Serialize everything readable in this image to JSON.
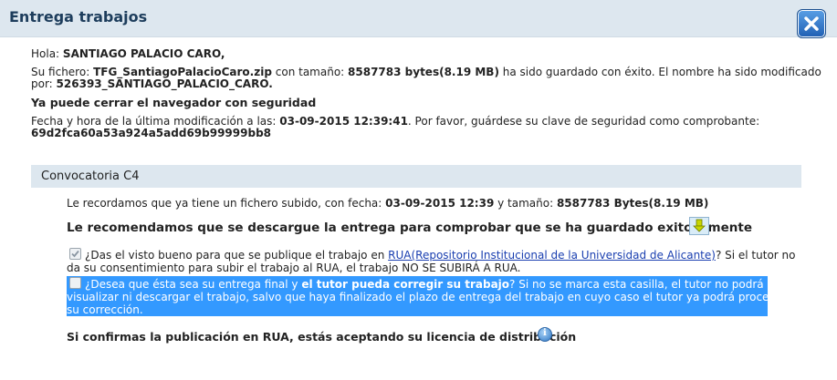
{
  "window": {
    "title": "Entrega trabajos",
    "close_label": "Cerrar"
  },
  "greeting": {
    "prefix": "Hola: ",
    "name": "SANTIAGO PALACIO CARO,"
  },
  "file": {
    "prefix": "Su fichero: ",
    "name": "TFG_SantiagoPalacioCaro.zip",
    "size_prefix": " con tamaño: ",
    "size": "8587783 bytes(8.19 MB)",
    "suffix": " ha sido guardado con éxito. El nombre ha sido modificado",
    "renamed_prefix": "por: ",
    "renamed": "526393_SANTIAGO_PALACIO_CARO."
  },
  "safe_close": "Ya puede cerrar el navegador con seguridad",
  "modified": {
    "prefix": "Fecha y hora de la última modificación a las: ",
    "datetime": "03-09-2015 12:39:41",
    "suffix": ". Por favor, guárdese su clave de seguridad como comprobante:",
    "key": "69d2fca60a53a924a5add69b99999bb8"
  },
  "convocatoria": {
    "title": "Convocatoria C4",
    "reminder_prefix": "Le recordamos que ya tiene un fichero subido, con fecha: ",
    "reminder_date": "03-09-2015 12:39",
    "reminder_mid": " y tamaño: ",
    "reminder_size": "8587783 Bytes(8.19 MB)",
    "recommend": "Le recomendamos que se descargue la entrega para comprobar que se ha guardado exitosamente",
    "download_icon": "download-arrow-icon",
    "rua_checkbox": {
      "checked": true,
      "text_before": "¿Das el visto bueno para que se publique el trabajo en ",
      "link": "RUA(Repositorio Institucional de la Universidad de Alicante)",
      "text_after": "? Si el tutor no",
      "line2": "da su consentimiento para subir el trabajo al RUA, el trabajo NO SE SUBIRÁ A RUA."
    },
    "final_checkbox": {
      "checked": false,
      "text1": "¿Desea que ésta sea su entrega final y ",
      "text1_bold": "el tutor pueda corregir su trabajo",
      "text1_after": "? Si no se marca esta casilla, el tutor no podrá",
      "line2": "visualizar ni descargar el trabajo, salvo que haya finalizado el plazo de entrega del trabajo en cuyo caso el tutor ya podrá proceder a",
      "line3": "su corrección."
    },
    "license_note": "Si confirmas la publicación en RUA, estás aceptando su licencia de distribución",
    "info_icon": "info-icon"
  },
  "colors": {
    "header_bg": "#dde7ef",
    "highlight": "#3399ff",
    "title": "#1d3d5c",
    "link": "#1a3fb0"
  }
}
